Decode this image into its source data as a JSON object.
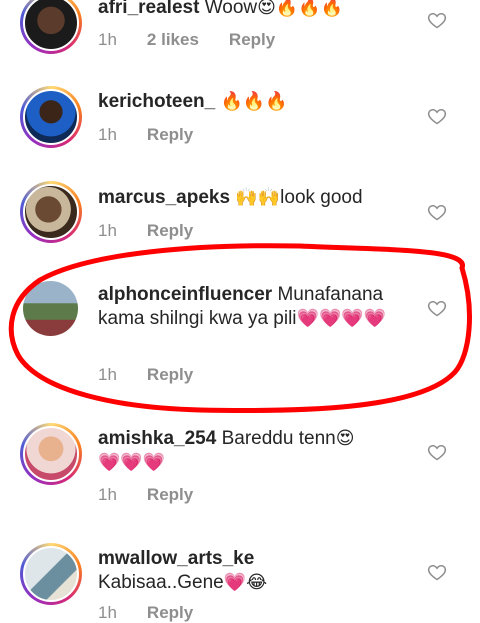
{
  "comments": [
    {
      "username": "afri_realest",
      "text": "Woow",
      "emoji": "😍🔥🔥🔥",
      "time": "1h",
      "likes": "2 likes",
      "reply": "Reply"
    },
    {
      "username": "kerichoteen_",
      "text": "",
      "emoji": "🔥🔥🔥",
      "time": "1h",
      "reply": "Reply"
    },
    {
      "username": "marcus_apeks",
      "emoji": "🙌🙌",
      "text": "look good",
      "time": "1h",
      "reply": "Reply"
    },
    {
      "username": "alphonceinfluencer",
      "text": "Munafanana kama shilngi kwa ya pili",
      "emoji": "💗💗💗💗",
      "time": "1h",
      "reply": "Reply"
    },
    {
      "username": "amishka_254",
      "text": "Bareddu tenn",
      "emoji": "😍",
      "emoji2": "💗💗💗",
      "time": "1h",
      "reply": "Reply"
    },
    {
      "username": "mwallow_arts_ke",
      "text": "Kabisaa..Gene",
      "emoji": "💗😂",
      "time": "1h",
      "reply": "Reply"
    }
  ],
  "colors": {
    "highlight": "#ff0000",
    "heart_pink": "#e8559b",
    "fire": "#f2641f"
  }
}
